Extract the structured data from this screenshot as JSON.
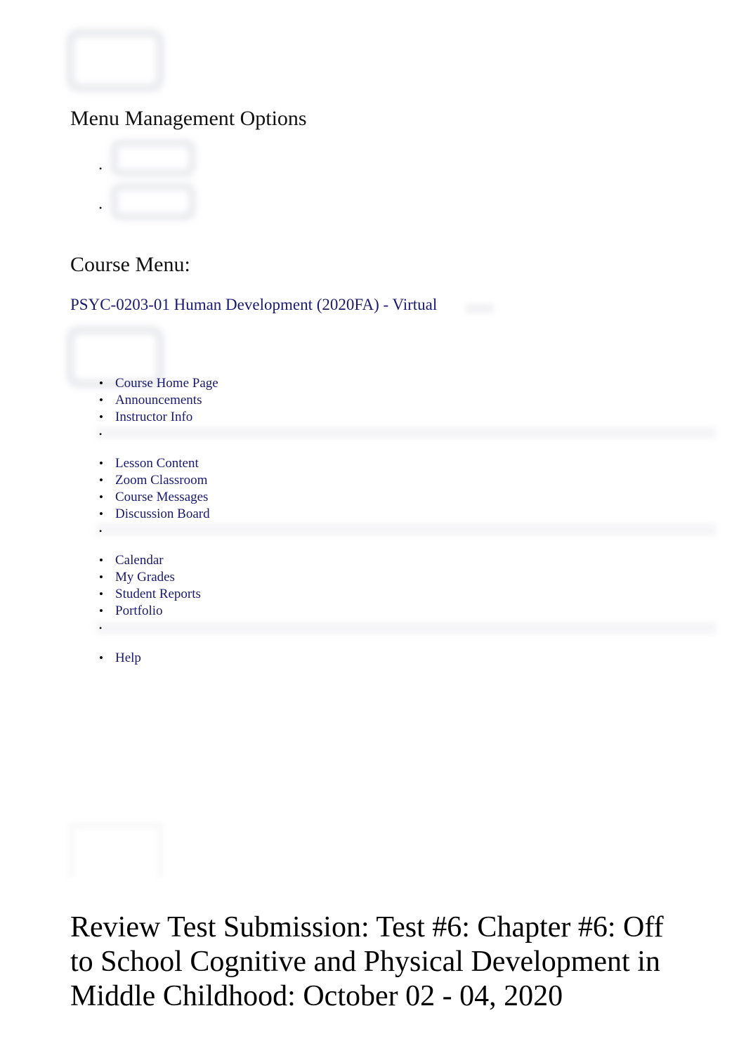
{
  "document": {
    "menu_management": {
      "heading": "Menu Management Options",
      "items": [
        {
          "label": "",
          "icon": "menu-placeholder-icon"
        },
        {
          "label": "",
          "icon": "menu-placeholder-icon"
        }
      ]
    },
    "course_menu": {
      "heading": "Course Menu:",
      "course_link": "PSYC-0203-01 Human Development (2020FA) - Virtual",
      "groups": [
        {
          "items": [
            {
              "label": "Course Home Page"
            },
            {
              "label": "Announcements"
            },
            {
              "label": "Instructor Info"
            },
            {
              "label": ""
            }
          ]
        },
        {
          "items": [
            {
              "label": "Lesson Content"
            },
            {
              "label": "Zoom Classroom"
            },
            {
              "label": "Course Messages"
            },
            {
              "label": "Discussion Board"
            },
            {
              "label": ""
            }
          ]
        },
        {
          "items": [
            {
              "label": "Calendar"
            },
            {
              "label": "My Grades"
            },
            {
              "label": "Student Reports"
            },
            {
              "label": "Portfolio"
            },
            {
              "label": ""
            }
          ]
        },
        {
          "items": [
            {
              "label": "Help"
            }
          ]
        }
      ]
    },
    "main": {
      "page_title": "Review Test Submission: Test #6: Chapter #6: Off to School Cognitive and Physical Development in Middle Childhood: October 02 - 04, 2020"
    },
    "colors": {
      "link": "#191970",
      "text": "#000000",
      "placeholder": "#e6e7ec",
      "band": "#f6f6f8",
      "background": "#ffffff"
    }
  }
}
